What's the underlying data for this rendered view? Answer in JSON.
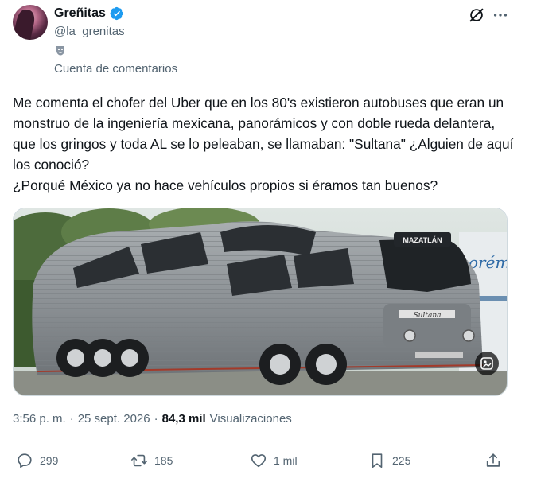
{
  "author": {
    "display_name": "Greñitas",
    "handle": "@la_grenitas",
    "verified": true,
    "account_label": "Cuenta de comentarios",
    "account_label_icon": "theater-masks-icon"
  },
  "header_icons": [
    "grok-icon",
    "more-icon"
  ],
  "tweet": {
    "text": "Me comenta el chofer del Uber que en los 80's existieron autobuses que eran un monstruo de la ingeniería mexicana, panorámicos y con doble rueda delantera, que los gringos y toda AL se lo peleaban, se llamaban: \"Sultana\" ¿Alguien de aquí los conoció?\n¿Porqué México ya no hace vehículos propios si éramos tan buenos?"
  },
  "media": {
    "bus_route_sign": "MAZATLÁN",
    "bus_name_plate": "Sultana",
    "badge_icon": "media-tags-icon"
  },
  "meta": {
    "time": "3:56 p. m.",
    "sep1": "·",
    "date": "25 sept. 2026",
    "sep2": "·",
    "views": "84,3 mil",
    "views_label": "Visualizaciones"
  },
  "actions": {
    "replies": "299",
    "reposts": "185",
    "likes": "1 mil",
    "bookmarks": "225"
  },
  "colors": {
    "text": "#0f1419",
    "secondary": "#536471",
    "verified_blue": "#1d9bf0",
    "divider": "#eff3f4"
  }
}
